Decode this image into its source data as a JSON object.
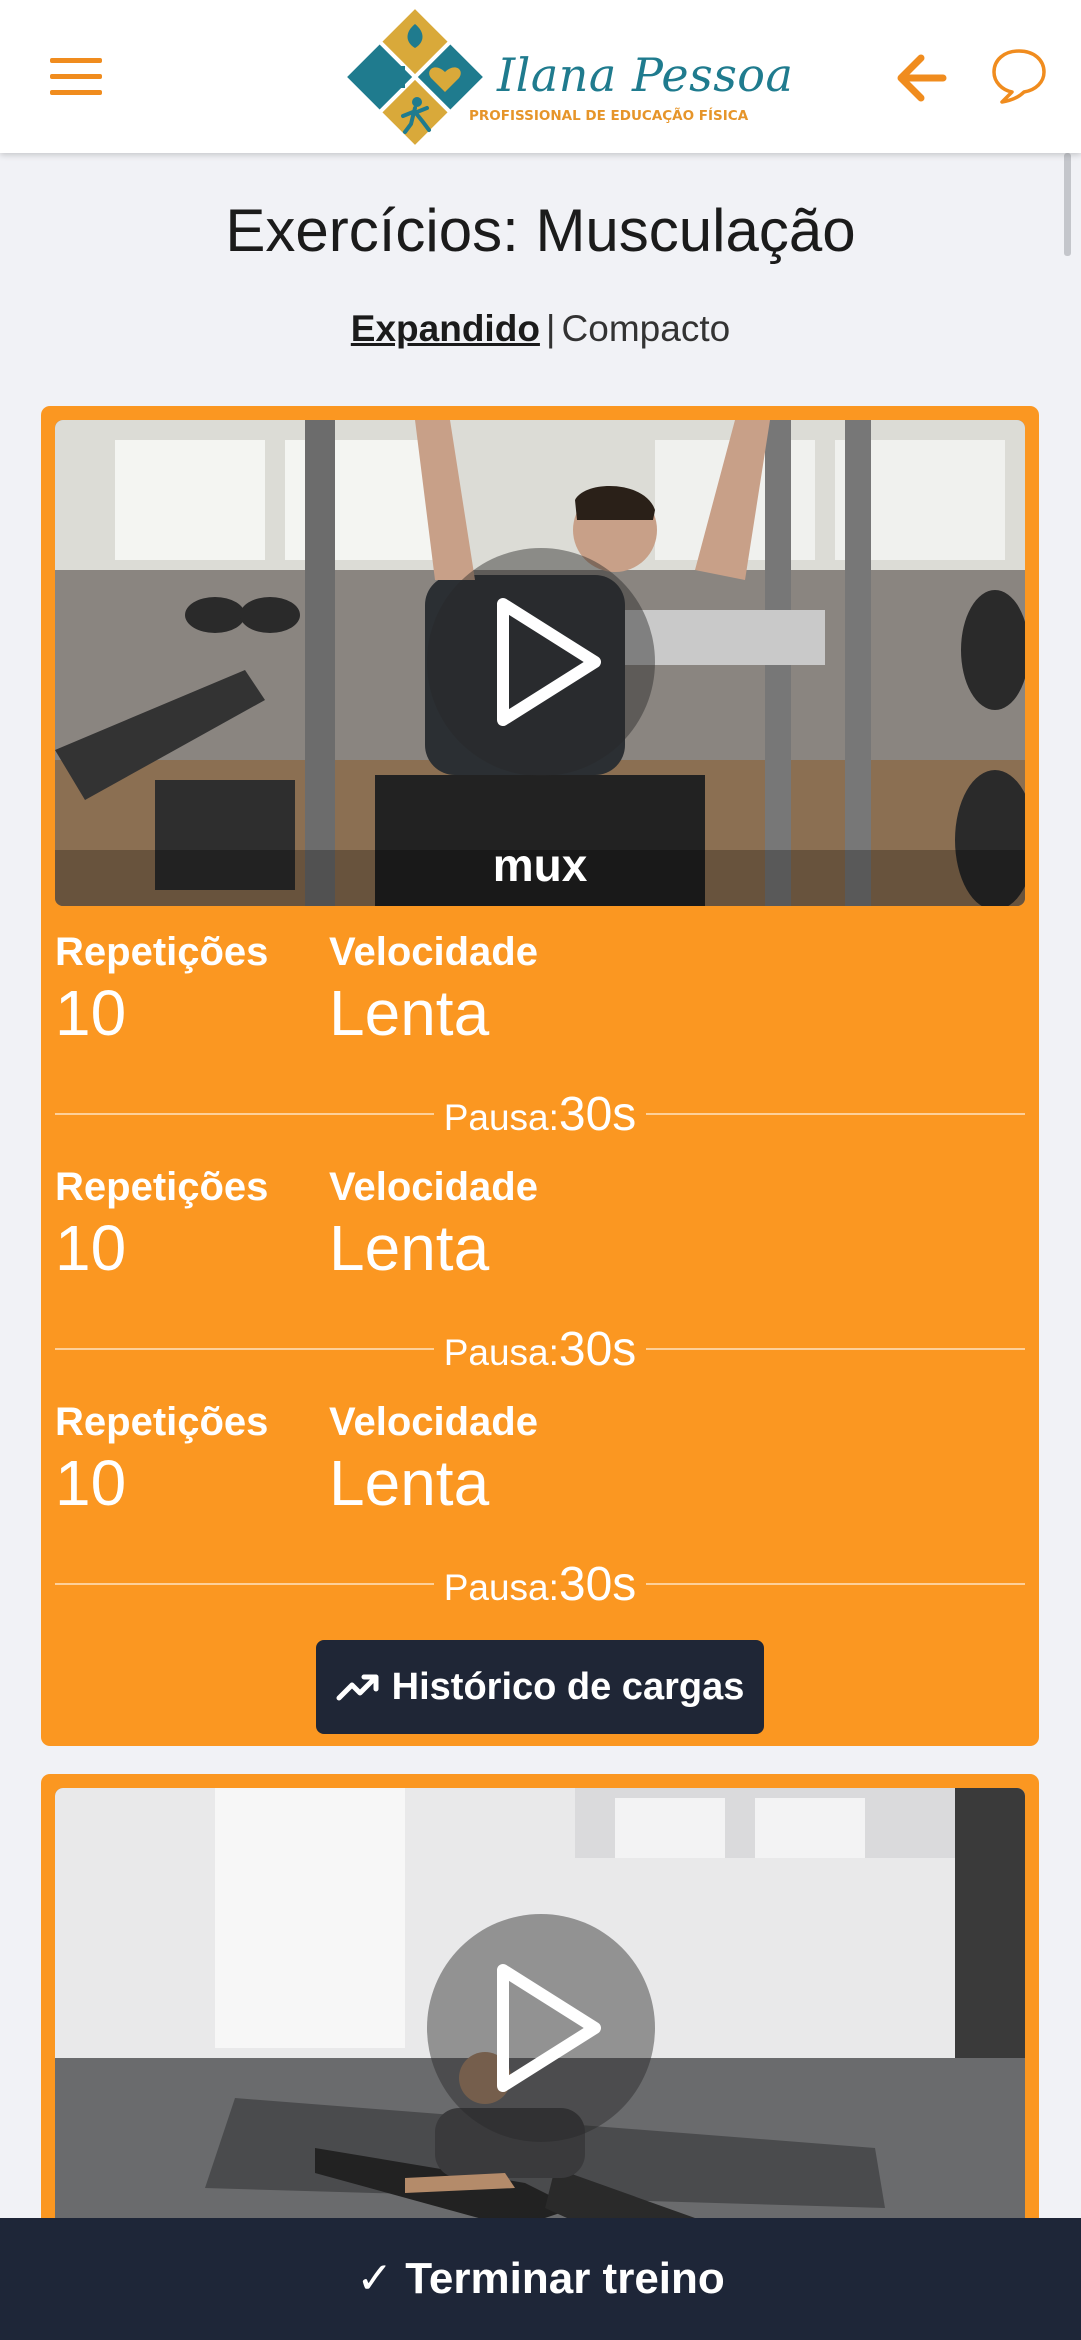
{
  "header": {
    "menu_icon": "hamburger-menu-icon",
    "logo": {
      "name": "Ilana Pessoa",
      "subtitle": "PROFISSIONAL DE EDUCAÇÃO FÍSICA",
      "colors": {
        "teal": "#1f7b8e",
        "gold": "#d9a93a",
        "orange": "#e6952a"
      }
    },
    "back_icon": "arrow-left-icon",
    "chat_icon": "chat-bubble-icon"
  },
  "page": {
    "title": "Exercícios: Musculação",
    "view_toggle": {
      "active": "Expandido",
      "separator": "|",
      "inactive": "Compacto"
    }
  },
  "exercises": [
    {
      "video_label": "mux",
      "sets": [
        {
          "rep_label": "Repetições",
          "reps": "10",
          "vel_label": "Velocidade",
          "velocity": "Lenta",
          "pause_label": "Pausa:",
          "pause": "30s"
        },
        {
          "rep_label": "Repetições",
          "reps": "10",
          "vel_label": "Velocidade",
          "velocity": "Lenta",
          "pause_label": "Pausa:",
          "pause": "30s"
        },
        {
          "rep_label": "Repetições",
          "reps": "10",
          "vel_label": "Velocidade",
          "velocity": "Lenta",
          "pause_label": "Pausa:",
          "pause": "30s"
        }
      ],
      "history_button": "Histórico de cargas"
    },
    {
      "video_label": ""
    }
  ],
  "footer": {
    "finish_label": "✓ Terminar treino"
  },
  "colors": {
    "accent": "#fb9721",
    "dark": "#1e2638",
    "background": "#f1f2f6"
  }
}
